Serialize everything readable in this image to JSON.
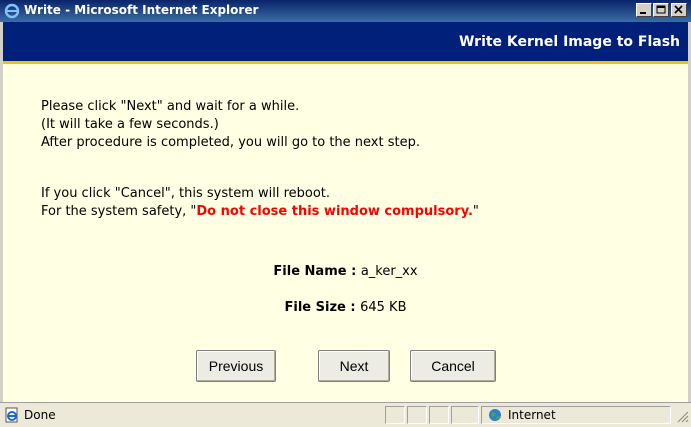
{
  "window": {
    "title": "Write - Microsoft Internet Explorer"
  },
  "header": {
    "title": "Write Kernel Image to Flash"
  },
  "content": {
    "line1": "Please click \"Next\" and wait for a while.",
    "line2": "(It will take a few seconds.)",
    "line3": "After procedure is completed, you will go to the next step.",
    "line4": "If you click \"Cancel\", this system will reboot.",
    "line5_prefix": "For the system safety, \"",
    "line5_warning": "Do not close this window compulsory.",
    "line5_suffix": "\"",
    "file_name_label": "File Name : ",
    "file_name_value": "a_ker_xx",
    "file_size_label": "File Size : ",
    "file_size_value": "645 KB"
  },
  "buttons": {
    "previous": "Previous",
    "next": "Next",
    "cancel": "Cancel"
  },
  "statusbar": {
    "status": "Done",
    "zone": "Internet"
  },
  "colors": {
    "header_bg": "#00207a",
    "accent_bar": "#f3c200",
    "content_bg": "#ffffe3",
    "warning": "#ff0000"
  }
}
